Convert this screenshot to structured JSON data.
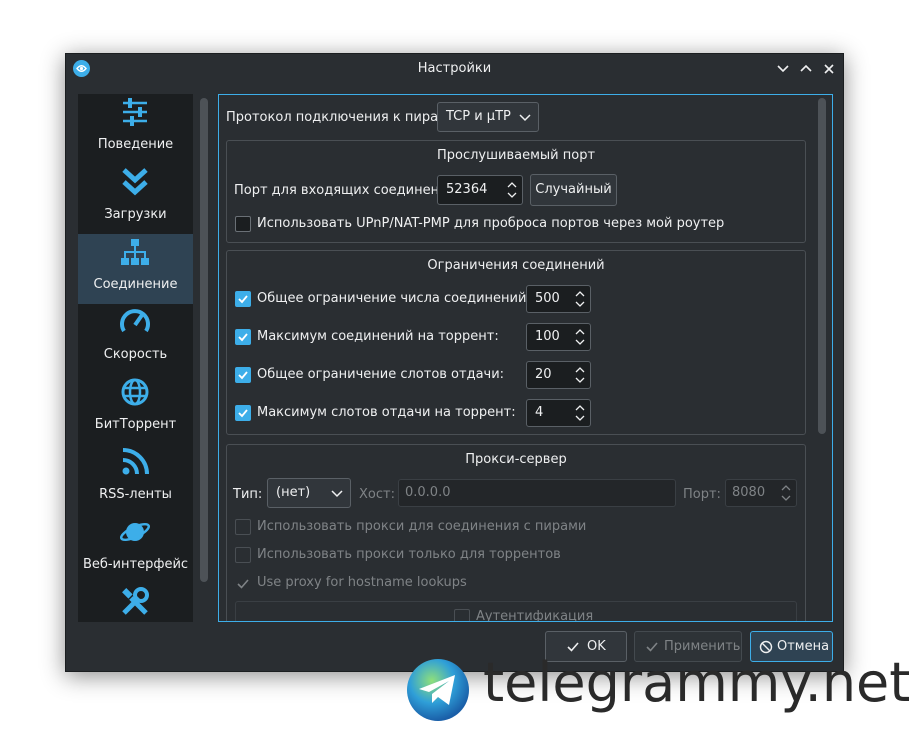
{
  "window": {
    "title": "Настройки",
    "controls": [
      "minimize",
      "maximize",
      "close"
    ]
  },
  "sidebar": {
    "items": [
      {
        "label": "Поведение",
        "icon": "sliders-icon",
        "active": false
      },
      {
        "label": "Загрузки",
        "icon": "double-chevron-down-icon",
        "active": false
      },
      {
        "label": "Соединение",
        "icon": "network-icon",
        "active": true
      },
      {
        "label": "Скорость",
        "icon": "speedometer-icon",
        "active": false
      },
      {
        "label": "БитТоррент",
        "icon": "globe-icon",
        "active": false
      },
      {
        "label": "RSS-ленты",
        "icon": "rss-icon",
        "active": false
      },
      {
        "label": "Веб-интерфейс",
        "icon": "planet-icon",
        "active": false
      },
      {
        "label": "",
        "icon": "tools-icon",
        "active": false
      }
    ]
  },
  "connection": {
    "protocol_label": "Протокол подключения к пирам:",
    "protocol_value": "TCP и µTP",
    "listening": {
      "title": "Прослушиваемый порт",
      "port_label": "Порт для входящих соединений:",
      "port_value": "52364",
      "random_button": "Случайный",
      "upnp_label": "Использовать UPnP/NAT-PMP для проброса портов через мой роутер",
      "upnp_checked": false
    },
    "limits": {
      "title": "Ограничения соединений",
      "rows": [
        {
          "label": "Общее ограничение числа соединений:",
          "value": "500",
          "checked": true
        },
        {
          "label": "Максимум соединений на торрент:",
          "value": "100",
          "checked": true
        },
        {
          "label": "Общее ограничение слотов отдачи:",
          "value": "20",
          "checked": true
        },
        {
          "label": "Максимум слотов отдачи на торрент:",
          "value": "4",
          "checked": true
        }
      ]
    },
    "proxy": {
      "title": "Прокси-сервер",
      "type_label": "Тип:",
      "type_value": "(нет)",
      "host_label": "Хост:",
      "host_value": "0.0.0.0",
      "port_label": "Порт:",
      "port_value": "8080",
      "use_for_peers": "Использовать прокси для соединения с пирами",
      "only_torrents": "Использовать прокси только для торрентов",
      "hostname_lookups": "Use proxy for hostname lookups",
      "auth_label": "Аутентификация"
    }
  },
  "buttons": {
    "ok": "OK",
    "apply": "Применить",
    "cancel": "Отмена"
  },
  "watermark": {
    "text": "telegrammy.net"
  },
  "colors": {
    "accent": "#3daee9",
    "window_bg": "#2a2e32",
    "sidebar_bg": "#1b1e20",
    "active_item": "#2f4353",
    "text": "#eff0f1"
  }
}
